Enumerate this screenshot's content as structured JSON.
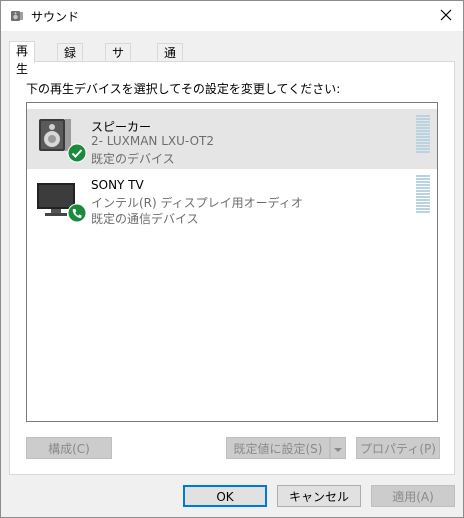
{
  "window": {
    "title": "サウンド",
    "close_icon": "close-icon"
  },
  "tabs": [
    {
      "label": "再生",
      "active": true
    },
    {
      "label": "録音",
      "active": false
    },
    {
      "label": "サウンド",
      "active": false
    },
    {
      "label": "通信",
      "active": false
    }
  ],
  "instruction": "下の再生デバイスを選択してその設定を変更してください:",
  "devices": [
    {
      "icon": "speaker-icon",
      "status_icon": "check-badge-icon",
      "name": "スピーカー",
      "line2": "2- LUXMAN LXU-OT2",
      "line3": "既定のデバイス",
      "selected": true
    },
    {
      "icon": "tv-monitor-icon",
      "status_icon": "phone-badge-icon",
      "name": "SONY TV",
      "line2": "インテル(R) ディスプレイ用オーディオ",
      "line3": "既定の通信デバイス",
      "selected": false
    }
  ],
  "panel_buttons": {
    "configure": "構成(C)",
    "set_default": "既定値に設定(S)",
    "properties": "プロパティ(P)"
  },
  "dialog_buttons": {
    "ok": "OK",
    "cancel": "キャンセル",
    "apply": "適用(A)"
  },
  "colors": {
    "accent": "#0078d7",
    "badge_green": "#1b8a3e",
    "meter": "#b9d3e0"
  }
}
